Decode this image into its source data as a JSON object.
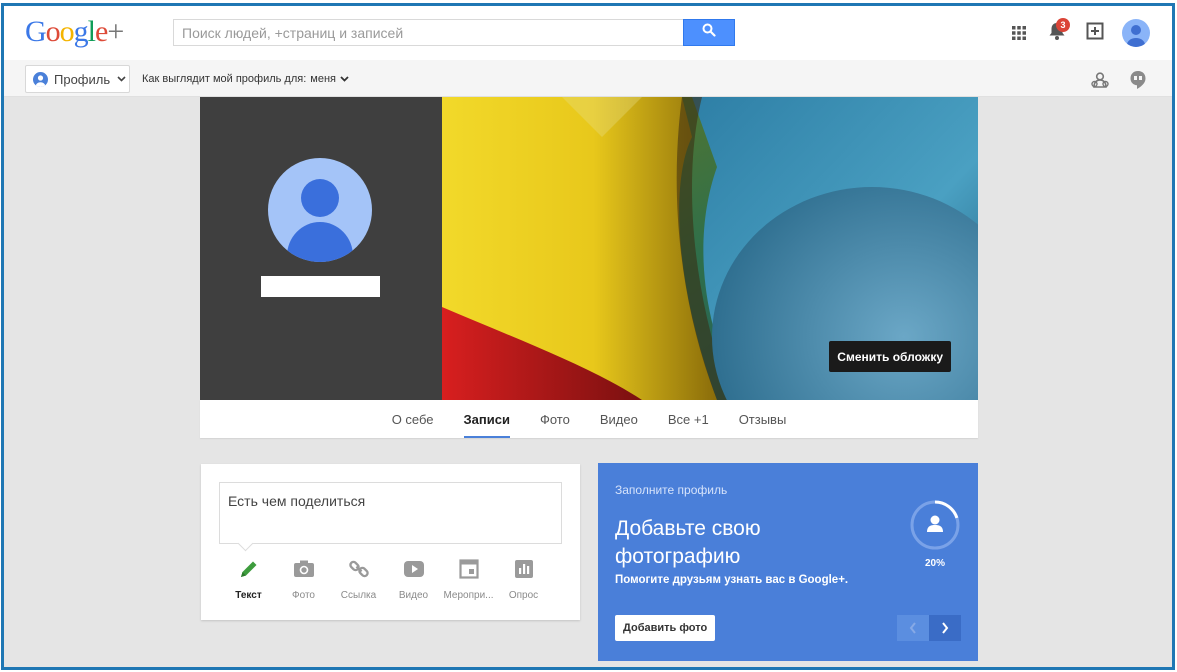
{
  "header": {
    "logo_text": "Google+",
    "search": {
      "placeholder": "Поиск людей, +страниц и записей"
    },
    "notifications_count": "3",
    "icons": [
      "apps-grid-icon",
      "bell-icon",
      "share-plus-icon",
      "account-avatar"
    ]
  },
  "subbar": {
    "profile_label": "Профиль",
    "viewas_label": "Как выглядит мой профиль для:",
    "viewas_value": "меня",
    "icons": [
      "circles-icon",
      "hangouts-icon"
    ]
  },
  "cover": {
    "change_cover_label": "Сменить обложку"
  },
  "tabs": [
    {
      "label": "О себе",
      "active": false
    },
    {
      "label": "Записи",
      "active": true
    },
    {
      "label": "Фото",
      "active": false
    },
    {
      "label": "Видео",
      "active": false
    },
    {
      "label": "Все +1",
      "active": false
    },
    {
      "label": "Отзывы",
      "active": false
    }
  ],
  "share": {
    "placeholder_text": "Есть чем поделиться",
    "actions": [
      {
        "label": "Текст",
        "icon": "pencil-icon",
        "active": true
      },
      {
        "label": "Фото",
        "icon": "camera-icon",
        "active": false
      },
      {
        "label": "Ссылка",
        "icon": "link-icon",
        "active": false
      },
      {
        "label": "Видео",
        "icon": "video-icon",
        "active": false
      },
      {
        "label": "Меропри...",
        "icon": "event-icon",
        "active": false
      },
      {
        "label": "Опрос",
        "icon": "poll-icon",
        "active": false
      }
    ]
  },
  "promo": {
    "kicker": "Заполните профиль",
    "title": "Добавьте свою фотографию",
    "subtitle": "Помогите друзьям узнать вас в Google+.",
    "progress_percent": "20%",
    "progress_fraction": 0.2,
    "add_photo_label": "Добавить фото"
  },
  "colors": {
    "accent_blue": "#4a7fd9",
    "search_blue": "#4d90fe",
    "badge_red": "#db4437",
    "pencil_green": "#3d9c3d"
  }
}
